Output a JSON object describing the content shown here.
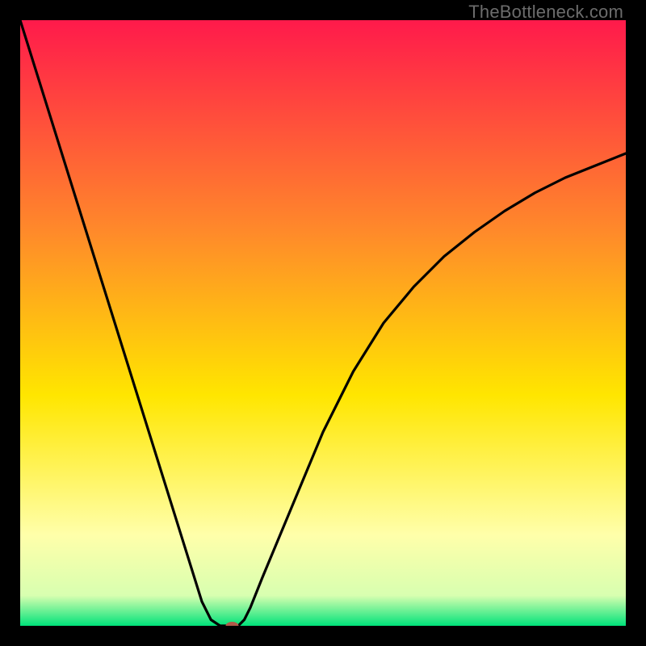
{
  "watermark": "TheBottleneck.com",
  "chart_data": {
    "type": "line",
    "title": "",
    "xlabel": "",
    "ylabel": "",
    "xlim": [
      0,
      100
    ],
    "ylim": [
      0,
      100
    ],
    "grid": false,
    "legend": false,
    "background_gradient_top": "#ff1a4b",
    "background_gradient_mid_upper": "#ff8a2a",
    "background_gradient_mid": "#ffe600",
    "background_gradient_lower": "#ffffaa",
    "background_gradient_bottom": "#00e27a",
    "series": [
      {
        "name": "bottleneck-curve",
        "color": "#000000",
        "x": [
          0,
          2.5,
          5,
          7.5,
          10,
          12.5,
          15,
          17.5,
          20,
          22.5,
          25,
          27.5,
          30,
          31.5,
          33,
          34,
          35,
          36,
          37,
          38,
          40,
          42.5,
          45,
          47.5,
          50,
          52.5,
          55,
          57.5,
          60,
          65,
          70,
          75,
          80,
          85,
          90,
          95,
          100
        ],
        "y": [
          100,
          92,
          84,
          76,
          68,
          60,
          52,
          44,
          36,
          28,
          20,
          12,
          4,
          1,
          0,
          0,
          0,
          0,
          1,
          3,
          8,
          14,
          20,
          26,
          32,
          37,
          42,
          46,
          50,
          56,
          61,
          65,
          68.5,
          71.5,
          74,
          76,
          78
        ]
      }
    ],
    "marker": {
      "x": 35,
      "y": 0,
      "color": "#b25a4a",
      "rx": 8,
      "ry": 5
    }
  }
}
